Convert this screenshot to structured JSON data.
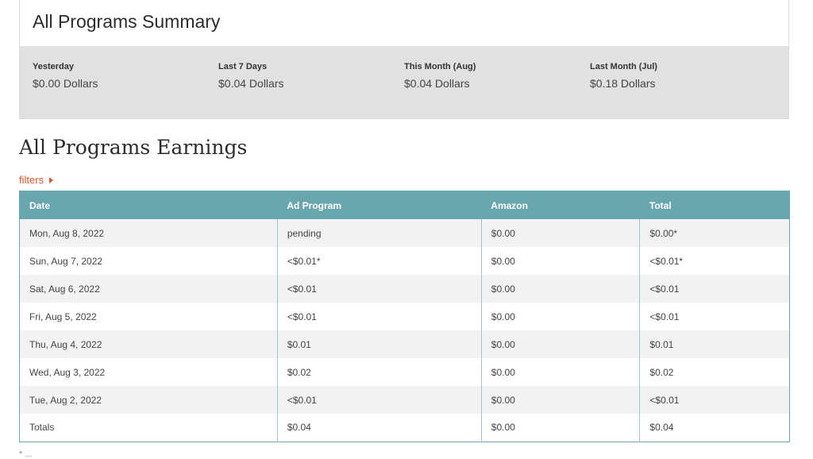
{
  "summary": {
    "title": "All Programs Summary",
    "stats": [
      {
        "label": "Yesterday",
        "value": "$0.00 Dollars"
      },
      {
        "label": "Last 7 Days",
        "value": "$0.04 Dollars"
      },
      {
        "label": "This Month (Aug)",
        "value": "$0.04 Dollars"
      },
      {
        "label": "Last Month (Jul)",
        "value": "$0.18 Dollars"
      }
    ]
  },
  "earnings": {
    "heading": "All Programs Earnings",
    "filters_label": "filters",
    "columns": [
      "Date",
      "Ad Program",
      "Amazon",
      "Total"
    ],
    "rows": [
      [
        "Mon, Aug 8, 2022",
        "pending",
        "$0.00",
        "$0.00*"
      ],
      [
        "Sun, Aug 7, 2022",
        "<$0.01*",
        "$0.00",
        "<$0.01*"
      ],
      [
        "Sat, Aug 6, 2022",
        "<$0.01",
        "$0.00",
        "<$0.01"
      ],
      [
        "Fri, Aug 5, 2022",
        "<$0.01",
        "$0.00",
        "<$0.01"
      ],
      [
        "Thu, Aug 4, 2022",
        "$0.01",
        "$0.00",
        "$0.01"
      ],
      [
        "Wed, Aug 3, 2022",
        "$0.02",
        "$0.00",
        "$0.02"
      ],
      [
        "Tue, Aug 2, 2022",
        "<$0.01",
        "$0.00",
        "<$0.01"
      ],
      [
        "Totals",
        "$0.04",
        "$0.00",
        "$0.04"
      ]
    ],
    "footnote": "* ... "
  },
  "colors": {
    "table_header": "#6aa6ae",
    "filters_link": "#d9542c",
    "summary_band": "#e1e1e1"
  }
}
